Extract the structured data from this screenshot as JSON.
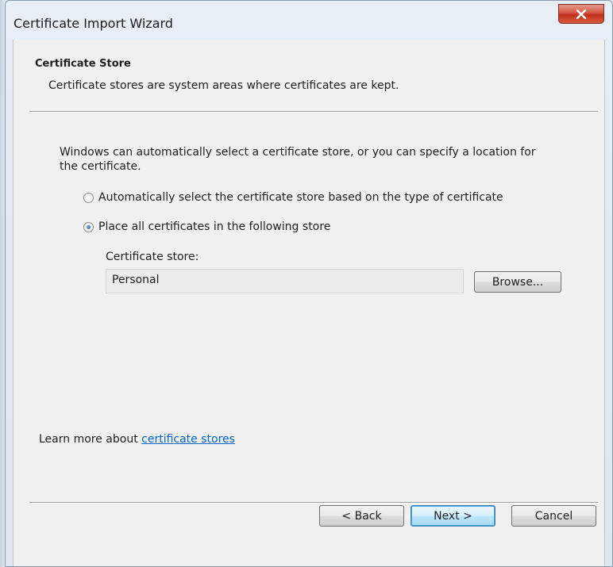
{
  "window": {
    "title": "Certificate Import Wizard",
    "close_icon": "close-x-icon",
    "accent_close": "#c1301b"
  },
  "header": {
    "title": "Certificate Store",
    "description": "Certificate stores are system areas where certificates are kept."
  },
  "body": {
    "intro": "Windows can automatically select a certificate store, or you can specify a location for the certificate.",
    "options": [
      {
        "label": "Automatically select the certificate store based on the type of certificate",
        "selected": false
      },
      {
        "label": "Place all certificates in the following store",
        "selected": true
      }
    ],
    "store_label": "Certificate store:",
    "store_value": "Personal",
    "browse_label": "Browse..."
  },
  "footer": {
    "learn_prefix": "Learn more about ",
    "learn_link": "certificate stores",
    "back_label": "< Back",
    "next_label": "Next >",
    "cancel_label": "Cancel"
  }
}
